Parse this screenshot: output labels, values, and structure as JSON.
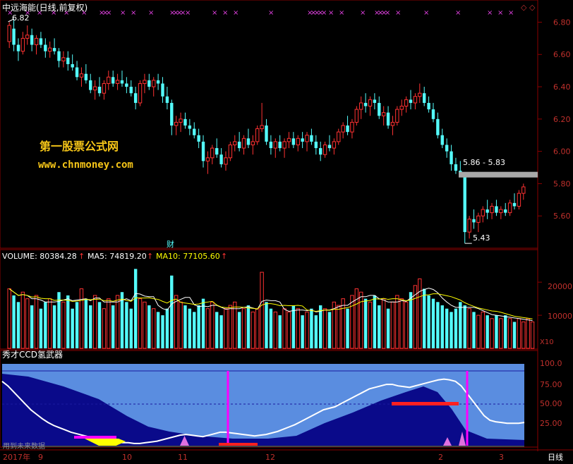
{
  "header": {
    "title": "中远海能(日线,前复权)",
    "title_color": "#ffffff",
    "indicator_label": "◇",
    "indicator_label2": "◇"
  },
  "price_panel": {
    "price_axis_labels": [
      "6.80",
      "6.60",
      "6.40",
      "6.20",
      "6.00",
      "5.80",
      "5.60"
    ],
    "high_label": "6.82",
    "low_label": "5.43",
    "resistance_label": "5.86 - 5.83",
    "finance_marker": "财",
    "watermark_title": "第一股票公式网",
    "watermark_url": "www.chnmoney.com",
    "watermark_color": "#f5c518"
  },
  "volume_panel": {
    "label_volume": "VOLUME: 80384.28",
    "label_ma5": "MA5: 74819.20",
    "label_ma10": "MA10: 77105.60",
    "axis_labels": [
      "20000",
      "10000"
    ],
    "multiplier": "X10"
  },
  "ccd_panel": {
    "title": "秀才CCD氢武器",
    "axis_labels": [
      "100.0",
      "75.00",
      "50.00",
      "25.00"
    ],
    "bottom_note": "用到未来数据"
  },
  "time_axis": {
    "labels": [
      "2017年",
      "9",
      "10",
      "11",
      "12",
      "2",
      "3"
    ],
    "period_label": "日线"
  },
  "colors": {
    "up": "#ff3232",
    "down": "#54fcfc",
    "grid": "#8b0000",
    "axis_text": "#c0302c",
    "ma5": "#ffffff",
    "ma10": "#ffff00",
    "ccd_light": "#5a8de0",
    "ccd_dark": "#0a0a8a",
    "magenta": "#ff00ff"
  },
  "chart_data": {
    "type": "candlestick",
    "title": "中远海能(日线,前复权)",
    "ylim": [
      5.4,
      6.85
    ],
    "annotations": {
      "max": 6.82,
      "min": 5.43,
      "band": [
        5.83,
        5.86
      ]
    },
    "candles": [
      [
        6.68,
        6.8,
        6.64,
        6.78
      ],
      [
        6.76,
        6.82,
        6.62,
        6.66
      ],
      [
        6.66,
        6.7,
        6.56,
        6.62
      ],
      [
        6.62,
        6.74,
        6.6,
        6.7
      ],
      [
        6.7,
        6.78,
        6.66,
        6.72
      ],
      [
        6.72,
        6.76,
        6.62,
        6.66
      ],
      [
        6.66,
        6.72,
        6.6,
        6.7
      ],
      [
        6.7,
        6.74,
        6.64,
        6.66
      ],
      [
        6.66,
        6.7,
        6.58,
        6.62
      ],
      [
        6.62,
        6.68,
        6.58,
        6.64
      ],
      [
        6.64,
        6.7,
        6.6,
        6.62
      ],
      [
        6.62,
        6.64,
        6.52,
        6.56
      ],
      [
        6.56,
        6.62,
        6.52,
        6.58
      ],
      [
        6.58,
        6.62,
        6.5,
        6.54
      ],
      [
        6.54,
        6.6,
        6.5,
        6.52
      ],
      [
        6.52,
        6.56,
        6.44,
        6.46
      ],
      [
        6.46,
        6.52,
        6.4,
        6.48
      ],
      [
        6.48,
        6.54,
        6.42,
        6.44
      ],
      [
        6.44,
        6.48,
        6.36,
        6.38
      ],
      [
        6.38,
        6.44,
        6.32,
        6.4
      ],
      [
        6.4,
        6.46,
        6.34,
        6.36
      ],
      [
        6.36,
        6.44,
        6.32,
        6.42
      ],
      [
        6.42,
        6.5,
        6.38,
        6.46
      ],
      [
        6.46,
        6.5,
        6.4,
        6.42
      ],
      [
        6.42,
        6.48,
        6.38,
        6.44
      ],
      [
        6.44,
        6.5,
        6.4,
        6.42
      ],
      [
        6.42,
        6.46,
        6.36,
        6.4
      ],
      [
        6.4,
        6.44,
        6.34,
        6.36
      ],
      [
        6.36,
        6.4,
        6.26,
        6.3
      ],
      [
        6.3,
        6.44,
        6.28,
        6.42
      ],
      [
        6.42,
        6.48,
        6.36,
        6.44
      ],
      [
        6.44,
        6.48,
        6.38,
        6.4
      ],
      [
        6.4,
        6.46,
        6.34,
        6.44
      ],
      [
        6.44,
        6.48,
        6.38,
        6.42
      ],
      [
        6.42,
        6.46,
        6.3,
        6.34
      ],
      [
        6.34,
        6.4,
        6.26,
        6.3
      ],
      [
        6.3,
        6.32,
        6.1,
        6.16
      ],
      [
        6.16,
        6.22,
        6.1,
        6.18
      ],
      [
        6.18,
        6.24,
        6.12,
        6.2
      ],
      [
        6.2,
        6.24,
        6.14,
        6.16
      ],
      [
        6.16,
        6.2,
        6.1,
        6.14
      ],
      [
        6.14,
        6.18,
        6.08,
        6.1
      ],
      [
        6.1,
        6.14,
        6.02,
        6.06
      ],
      [
        6.06,
        6.1,
        5.9,
        5.94
      ],
      [
        5.94,
        6.0,
        5.86,
        5.96
      ],
      [
        5.96,
        6.04,
        5.92,
        6.02
      ],
      [
        6.02,
        6.08,
        5.96,
        5.98
      ],
      [
        5.98,
        6.02,
        5.9,
        5.92
      ],
      [
        5.92,
        6.0,
        5.88,
        5.96
      ],
      [
        5.96,
        6.06,
        5.94,
        6.04
      ],
      [
        6.04,
        6.1,
        6.0,
        6.06
      ],
      [
        6.06,
        6.12,
        6.0,
        6.02
      ],
      [
        6.02,
        6.1,
        5.98,
        6.08
      ],
      [
        6.08,
        6.14,
        6.02,
        6.04
      ],
      [
        6.04,
        6.1,
        5.98,
        6.06
      ],
      [
        6.06,
        6.16,
        6.04,
        6.14
      ],
      [
        6.14,
        6.3,
        6.12,
        6.16
      ],
      [
        6.16,
        6.2,
        6.04,
        6.06
      ],
      [
        6.06,
        6.1,
        5.98,
        6.02
      ],
      [
        6.02,
        6.08,
        5.96,
        6.06
      ],
      [
        6.06,
        6.1,
        6.0,
        6.02
      ],
      [
        6.02,
        6.08,
        5.96,
        6.06
      ],
      [
        6.06,
        6.12,
        6.02,
        6.08
      ],
      [
        6.08,
        6.12,
        6.02,
        6.04
      ],
      [
        6.04,
        6.1,
        6.0,
        6.08
      ],
      [
        6.08,
        6.12,
        6.02,
        6.06
      ],
      [
        6.06,
        6.12,
        6.0,
        6.1
      ],
      [
        6.1,
        6.14,
        6.04,
        6.06
      ],
      [
        6.06,
        6.1,
        5.98,
        6.02
      ],
      [
        6.02,
        6.06,
        5.94,
        5.98
      ],
      [
        5.98,
        6.06,
        5.96,
        6.04
      ],
      [
        6.04,
        6.1,
        6.0,
        6.02
      ],
      [
        6.02,
        6.08,
        5.98,
        6.06
      ],
      [
        6.06,
        6.14,
        6.04,
        6.12
      ],
      [
        6.12,
        6.18,
        6.08,
        6.16
      ],
      [
        6.16,
        6.22,
        6.1,
        6.12
      ],
      [
        6.12,
        6.2,
        6.08,
        6.18
      ],
      [
        6.18,
        6.28,
        6.16,
        6.26
      ],
      [
        6.26,
        6.34,
        6.2,
        6.3
      ],
      [
        6.3,
        6.36,
        6.24,
        6.28
      ],
      [
        6.28,
        6.34,
        6.22,
        6.32
      ],
      [
        6.32,
        6.36,
        6.26,
        6.3
      ],
      [
        6.3,
        6.34,
        6.2,
        6.22
      ],
      [
        6.22,
        6.28,
        6.16,
        6.24
      ],
      [
        6.24,
        6.28,
        6.14,
        6.16
      ],
      [
        6.16,
        6.22,
        6.1,
        6.18
      ],
      [
        6.18,
        6.28,
        6.16,
        6.26
      ],
      [
        6.26,
        6.32,
        6.22,
        6.28
      ],
      [
        6.28,
        6.34,
        6.24,
        6.32
      ],
      [
        6.32,
        6.38,
        6.26,
        6.3
      ],
      [
        6.3,
        6.36,
        6.26,
        6.34
      ],
      [
        6.34,
        6.42,
        6.3,
        6.36
      ],
      [
        6.36,
        6.4,
        6.28,
        6.3
      ],
      [
        6.3,
        6.34,
        6.24,
        6.26
      ],
      [
        6.26,
        6.3,
        6.18,
        6.2
      ],
      [
        6.2,
        6.24,
        6.08,
        6.1
      ],
      [
        6.1,
        6.14,
        6.02,
        6.04
      ],
      [
        6.04,
        6.08,
        5.96,
        6.0
      ],
      [
        6.0,
        6.04,
        5.88,
        5.92
      ],
      [
        5.92,
        5.96,
        5.86,
        5.88
      ],
      [
        5.88,
        5.94,
        5.84,
        5.86
      ],
      [
        5.86,
        5.86,
        5.43,
        5.5
      ],
      [
        5.5,
        5.6,
        5.46,
        5.58
      ],
      [
        5.58,
        5.64,
        5.52,
        5.56
      ],
      [
        5.56,
        5.62,
        5.5,
        5.6
      ],
      [
        5.6,
        5.66,
        5.56,
        5.64
      ],
      [
        5.64,
        5.7,
        5.58,
        5.62
      ],
      [
        5.62,
        5.68,
        5.58,
        5.66
      ],
      [
        5.66,
        5.7,
        5.6,
        5.62
      ],
      [
        5.62,
        5.66,
        5.58,
        5.64
      ],
      [
        5.64,
        5.68,
        5.6,
        5.62
      ],
      [
        5.62,
        5.7,
        5.6,
        5.68
      ],
      [
        5.68,
        5.74,
        5.64,
        5.66
      ],
      [
        5.66,
        5.76,
        5.64,
        5.74
      ],
      [
        5.74,
        5.8,
        5.7,
        5.78
      ]
    ],
    "volume": [
      18,
      16,
      14,
      17,
      15,
      13,
      16,
      12,
      14,
      15,
      13,
      17,
      14,
      16,
      12,
      14,
      18,
      15,
      13,
      16,
      14,
      12,
      15,
      13,
      16,
      17,
      14,
      12,
      24,
      15,
      14,
      13,
      12,
      11,
      10,
      12,
      22,
      16,
      14,
      13,
      12,
      11,
      13,
      15,
      12,
      14,
      11,
      10,
      12,
      13,
      14,
      11,
      12,
      13,
      11,
      12,
      23,
      14,
      12,
      11,
      10,
      12,
      11,
      13,
      12,
      10,
      11,
      12,
      10,
      13,
      12,
      11,
      14,
      13,
      15,
      12,
      16,
      18,
      17,
      15,
      14,
      16,
      13,
      15,
      12,
      14,
      16,
      15,
      14,
      17,
      19,
      21,
      18,
      16,
      15,
      14,
      13,
      12,
      11,
      12,
      14,
      13,
      12,
      11,
      10,
      11,
      10,
      9,
      10,
      9,
      10,
      9,
      8,
      9,
      8,
      9,
      8
    ],
    "volume_ylim": [
      0,
      26000
    ],
    "ccd": {
      "ylim": [
        0,
        100
      ],
      "white_line": [
        86,
        80,
        72,
        64,
        56,
        48,
        42,
        36,
        31,
        27,
        24,
        21,
        18,
        16,
        14,
        12,
        10,
        9,
        8,
        6,
        5,
        4,
        4,
        3,
        3,
        4,
        5,
        6,
        8,
        10,
        12,
        14,
        15,
        14,
        13,
        12,
        14,
        16,
        18,
        18,
        17,
        16,
        15,
        14,
        13,
        14,
        15,
        17,
        19,
        22,
        25,
        28,
        32,
        36,
        40,
        44,
        48,
        50,
        52,
        56,
        60,
        64,
        68,
        72,
        76,
        78,
        80,
        82,
        82,
        80,
        79,
        78,
        80,
        82,
        84,
        86,
        88,
        89,
        88,
        86,
        80,
        70,
        60,
        50,
        40,
        34,
        32,
        31,
        30,
        30,
        30,
        31
      ]
    }
  }
}
